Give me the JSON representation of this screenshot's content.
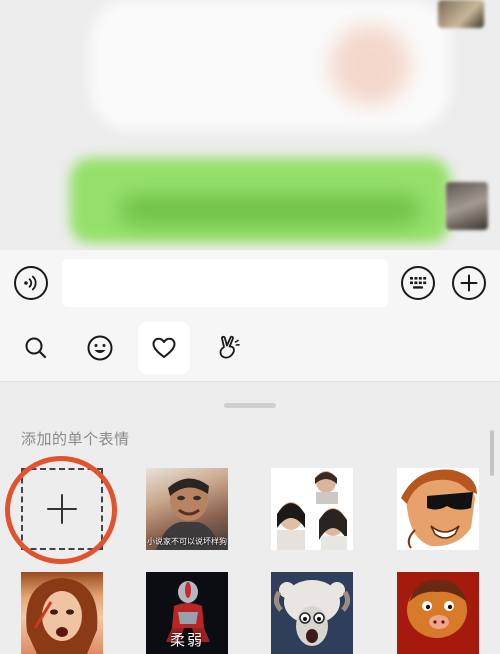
{
  "chat": {},
  "input_bar": {
    "voice_icon": "voice-icon",
    "keyboard_icon": "keyboard-icon",
    "more_icon": "plus-icon"
  },
  "tabs": [
    {
      "icon": "search-icon"
    },
    {
      "icon": "smile-icon"
    },
    {
      "icon": "heart-icon",
      "active": true
    },
    {
      "icon": "hand-gesture-icon"
    }
  ],
  "panel": {
    "section_title": "添加的单个表情",
    "stickers": [
      {
        "kind": "add",
        "icon": "plus-icon"
      },
      {
        "caption": "小说家不可以说坏样狗"
      },
      {
        "caption": ""
      },
      {
        "caption": ""
      },
      {
        "caption": ""
      },
      {
        "caption": "柔弱"
      },
      {
        "caption": ""
      },
      {
        "caption": ""
      }
    ]
  },
  "colors": {
    "background": "#ededed",
    "bar": "#f6f6f6",
    "highlight_circle": "#e1522d"
  }
}
